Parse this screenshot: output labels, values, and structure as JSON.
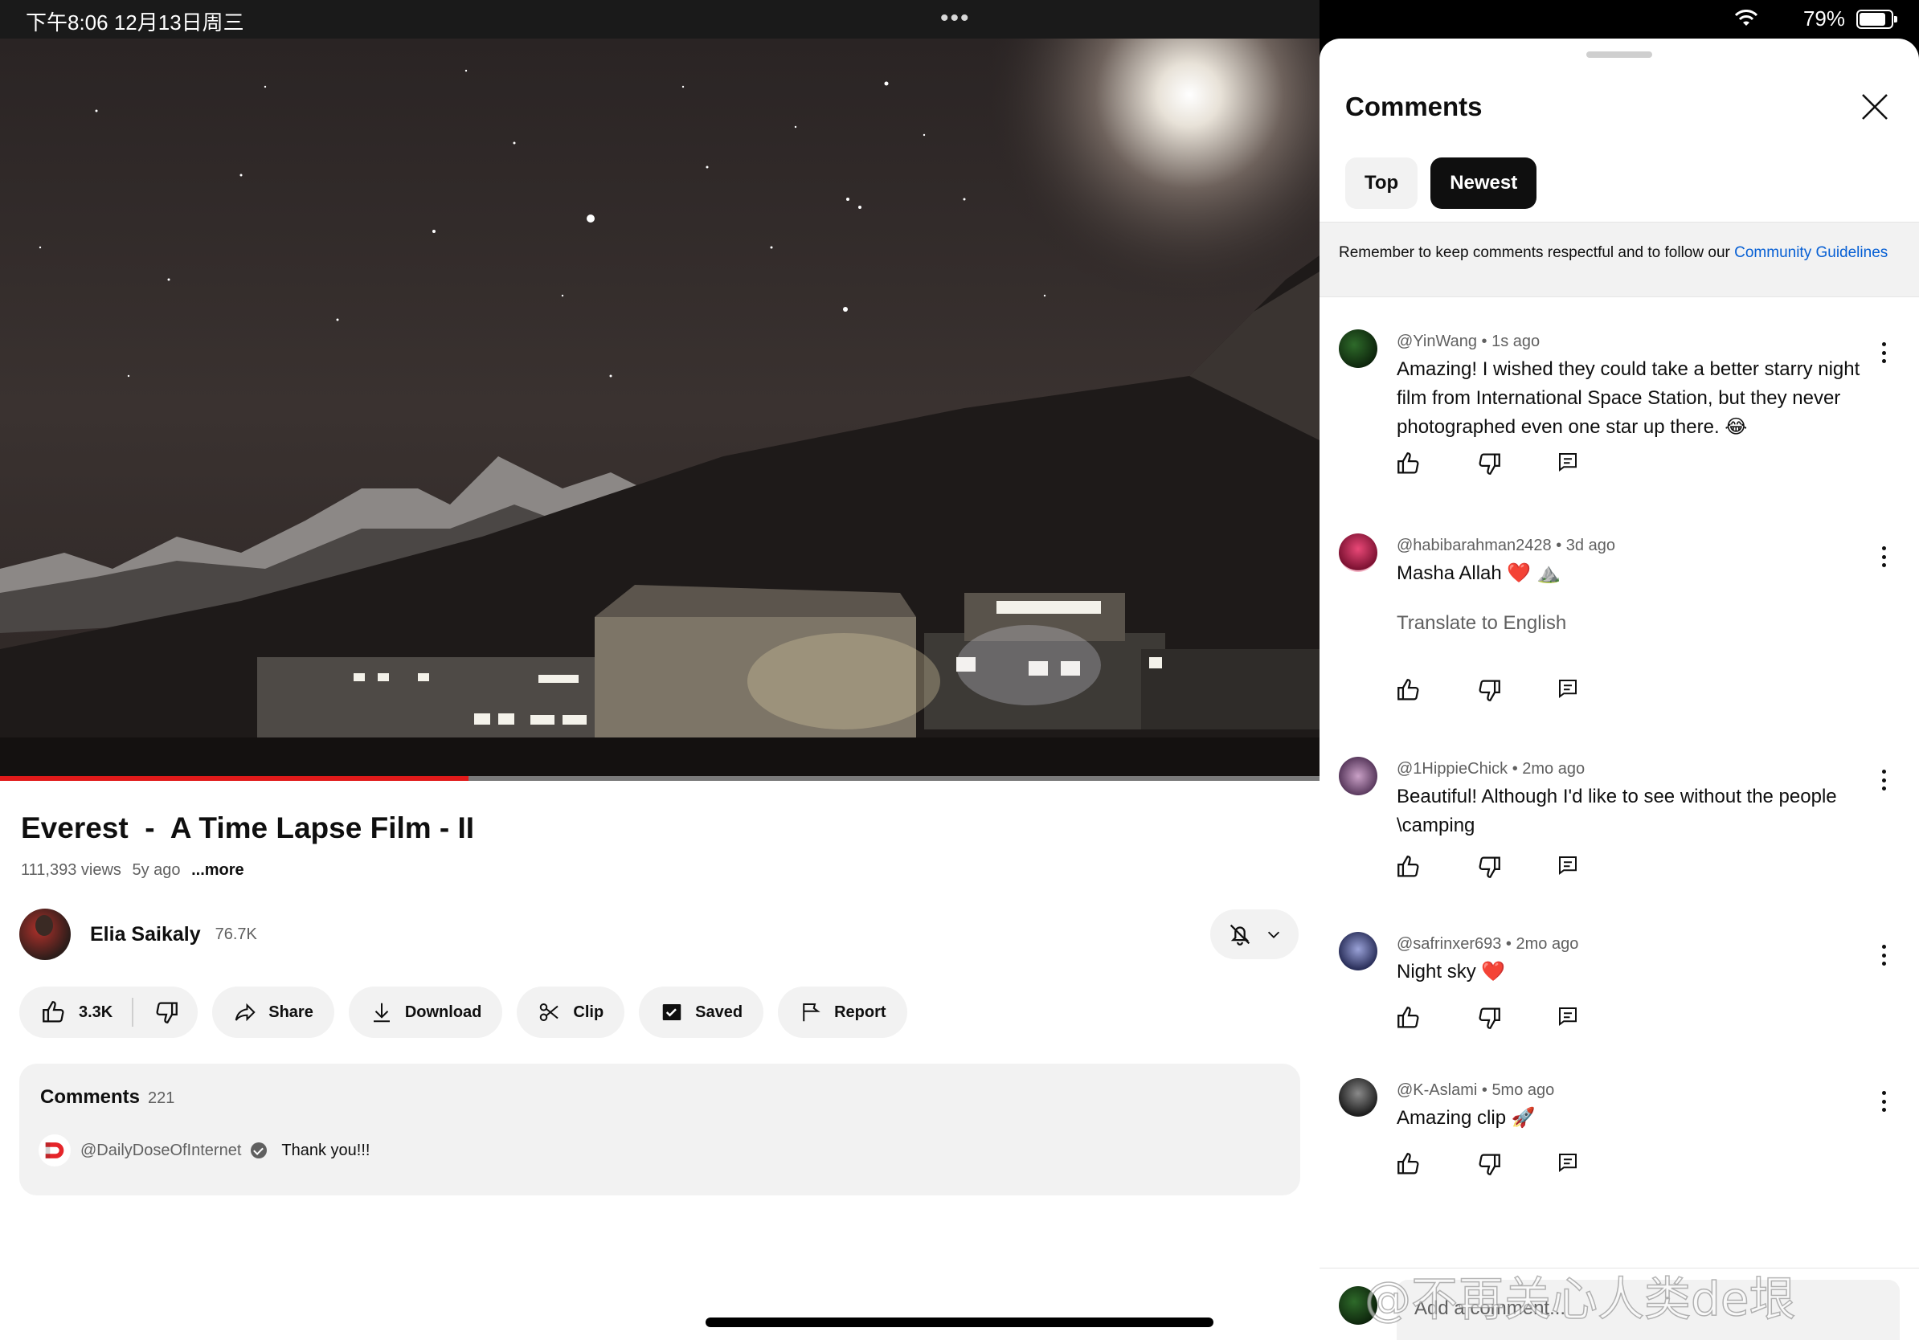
{
  "status": {
    "time": "下午8:06   12月13日周三",
    "battery": "79%"
  },
  "video": {
    "progress_fraction": 0.355
  },
  "info": {
    "title": "Everest  -  A Time Lapse Film - II",
    "views": "111,393 views",
    "age": "5y ago",
    "more": "...more"
  },
  "channel": {
    "name": "Elia Saikaly",
    "subs": "76.7K"
  },
  "actions": {
    "likes": "3.3K",
    "share": "Share",
    "download": "Download",
    "clip": "Clip",
    "saved": "Saved",
    "report": "Report"
  },
  "comments_card": {
    "label": "Comments",
    "count": "221",
    "user": "@DailyDoseOfInternet",
    "text": "Thank you!!!"
  },
  "panel": {
    "title": "Comments",
    "tabs": [
      "Top",
      "Newest"
    ],
    "notice_text": "Remember to keep comments respectful and to follow our ",
    "notice_link": "Community Guidelines",
    "add_placeholder": "Add a comment..."
  },
  "comments": [
    {
      "user": "@YinWang",
      "time": "1s ago",
      "text": "Amazing! I wished they could take a better starry night film from International Space Station, but they never photographed even one star up there. 😂"
    },
    {
      "user": "@habibarahman2428",
      "time": "3d ago",
      "text": "Masha Allah ❤️ ⛰️",
      "translate": "Translate to English"
    },
    {
      "user": "@1HippieChick",
      "time": "2mo ago",
      "text": "Beautiful! Although I'd like to see without the people \\camping"
    },
    {
      "user": "@safrinxer693",
      "time": "2mo ago",
      "text": "Night sky ❤️"
    },
    {
      "user": "@K-Aslami",
      "time": "5mo ago",
      "text": "Amazing clip 🚀"
    }
  ],
  "watermark": "@不再关心人类de垠"
}
